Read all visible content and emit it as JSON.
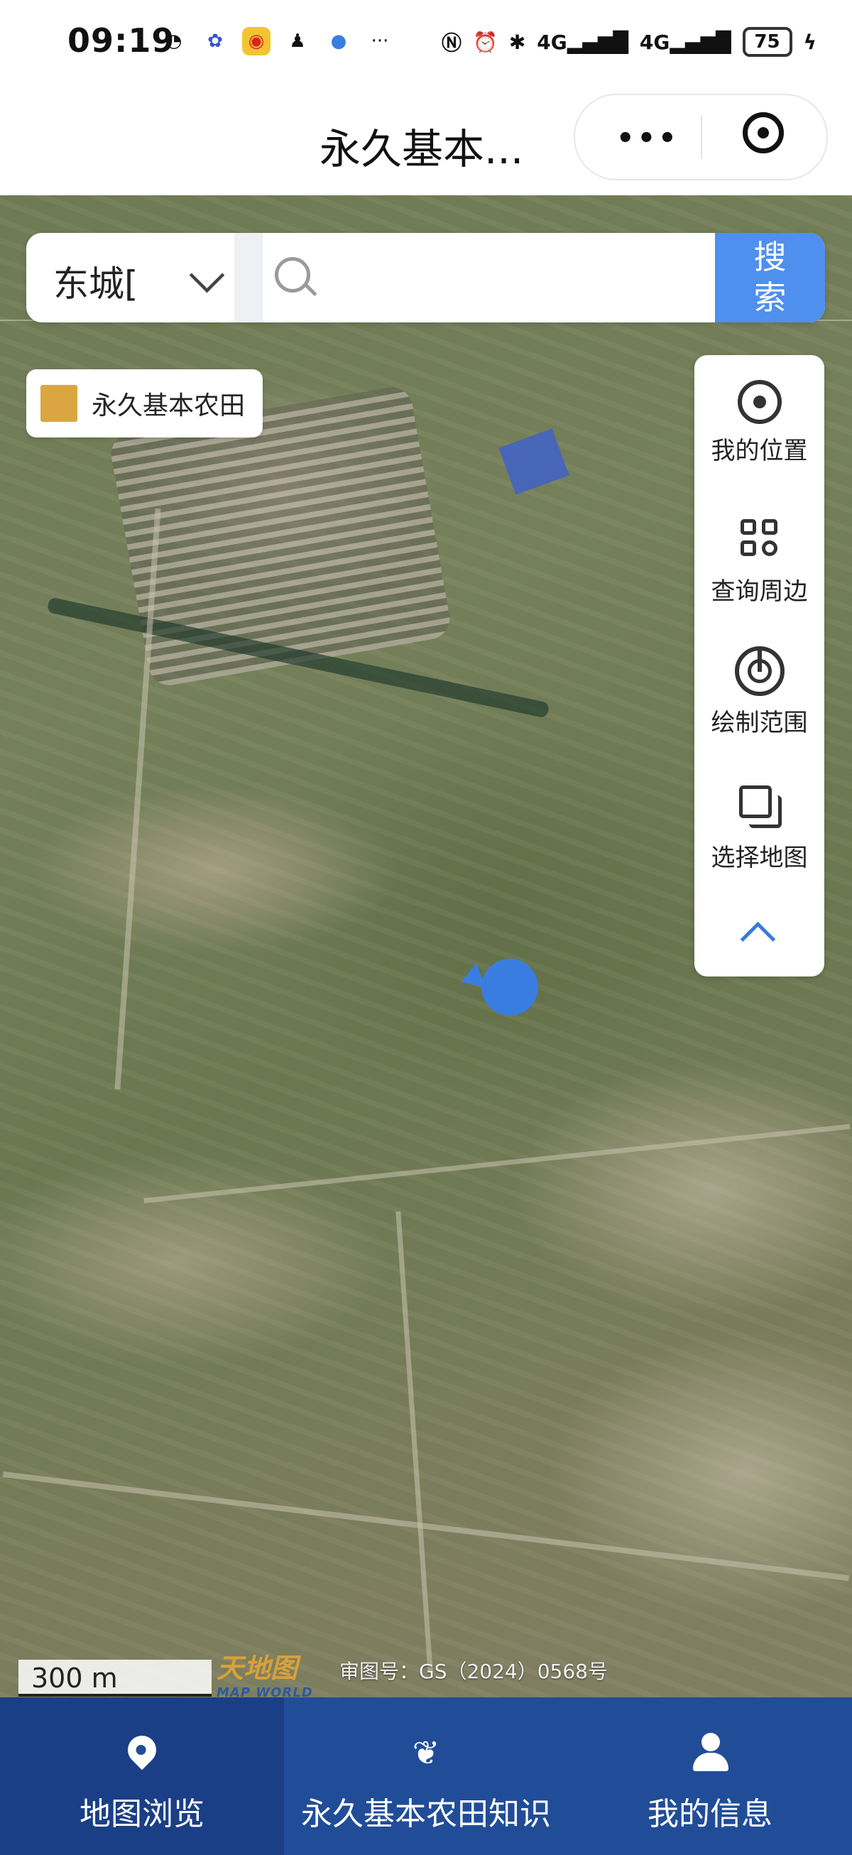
{
  "status_bar": {
    "time": "09:19",
    "battery": "75",
    "network_1": "4G",
    "network_2": "4G",
    "more": "···"
  },
  "title_bar": {
    "title": "永久基本...",
    "more_label": "•••"
  },
  "search": {
    "city": "东城[",
    "placeholder": "",
    "button_label": "搜\n索"
  },
  "legend": {
    "label": "永久基本农田",
    "color": "#dba641"
  },
  "tools": [
    {
      "label": "我的位置",
      "icon": "locate-icon"
    },
    {
      "label": "查询周边",
      "icon": "query-nearby-icon"
    },
    {
      "label": "绘制范围",
      "icon": "draw-range-icon"
    },
    {
      "label": "选择地图",
      "icon": "select-map-icon"
    }
  ],
  "map": {
    "scale": "300 m",
    "logo_text": "天地图",
    "logo_sub": "MAP WORLD",
    "attribution": "审图号：GS（2024）0568号"
  },
  "tabs": [
    {
      "label": "地图浏览",
      "icon": "map-browse-icon",
      "active": true
    },
    {
      "label": "永久基本农田知识",
      "icon": "wheat-icon",
      "active": false
    },
    {
      "label": "我的信息",
      "icon": "user-icon",
      "active": false
    }
  ],
  "colors": {
    "accent": "#4f8fee",
    "tabbar": "#214d98",
    "marker": "#3a7de0"
  }
}
